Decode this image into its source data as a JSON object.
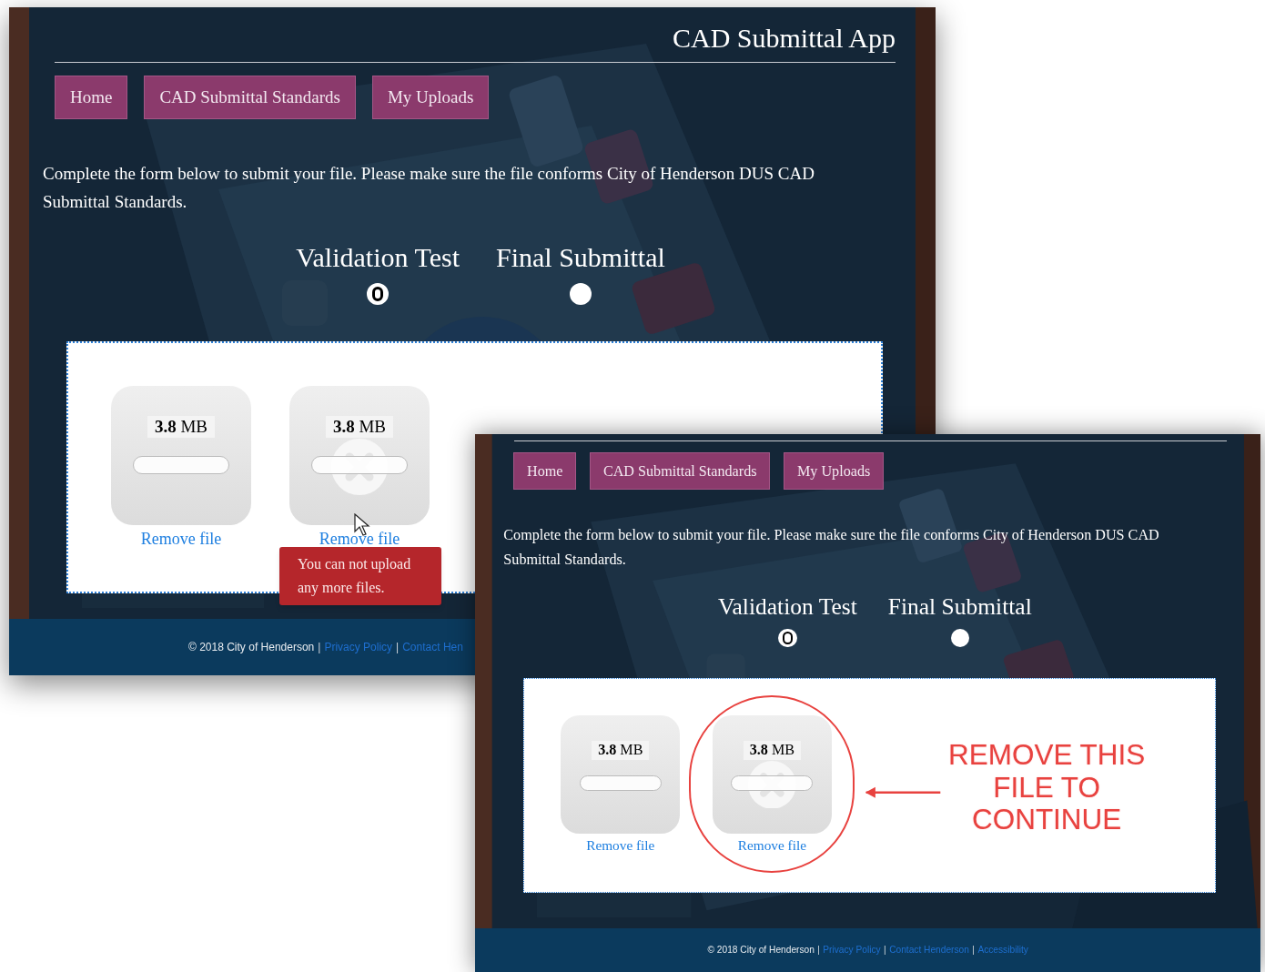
{
  "windows": [
    {
      "title": "CAD Submittal App",
      "nav": [
        {
          "label": "Home"
        },
        {
          "label": "CAD Submittal Standards"
        },
        {
          "label": "My Uploads"
        }
      ],
      "intro": "Complete the form below to submit your file. Please make sure the file conforms City of Henderson DUS CAD Submittal Standards.",
      "options": [
        {
          "label": "Validation Test",
          "selected": true
        },
        {
          "label": "Final Submittal",
          "selected": false
        }
      ],
      "files": [
        {
          "size": "**3.8** MB",
          "action": "Remove file",
          "failed": false
        },
        {
          "size": "**3.8** MB",
          "action": "Remove file",
          "failed": true
        }
      ],
      "tooltip": "You can not upload any more files.",
      "footer": [
        {
          "kind": "text",
          "text": "© 2018 City of Henderson"
        },
        {
          "kind": "separator",
          "text": "|"
        },
        {
          "kind": "link",
          "text": "Privacy Policy"
        },
        {
          "kind": "separator",
          "text": "|"
        },
        {
          "kind": "link",
          "text": "Contact Hen"
        }
      ]
    },
    {
      "nav": [
        {
          "label": "Home"
        },
        {
          "label": "CAD Submittal Standards"
        },
        {
          "label": "My Uploads"
        }
      ],
      "intro": "Complete the form below to submit your file. Please make sure the file conforms City of Henderson DUS CAD Submittal Standards.",
      "options": [
        {
          "label": "Validation Test",
          "selected": true
        },
        {
          "label": "Final Submittal",
          "selected": false
        }
      ],
      "files": [
        {
          "size": "**3.8** MB",
          "action": "Remove file",
          "failed": false
        },
        {
          "size": "**3.8** MB",
          "action": "Remove file",
          "failed": true,
          "highlighted": true
        }
      ],
      "annotation": "REMOVE THIS FILE TO CONTINUE",
      "footer": [
        {
          "kind": "text",
          "text": "© 2018 City of Henderson"
        },
        {
          "kind": "separator",
          "text": "|"
        },
        {
          "kind": "link",
          "text": "Privacy Policy"
        },
        {
          "kind": "separator",
          "text": "|"
        },
        {
          "kind": "link",
          "text": "Contact Henderson"
        },
        {
          "kind": "separator",
          "text": "|"
        },
        {
          "kind": "link",
          "text": "Accessibility"
        }
      ]
    }
  ]
}
